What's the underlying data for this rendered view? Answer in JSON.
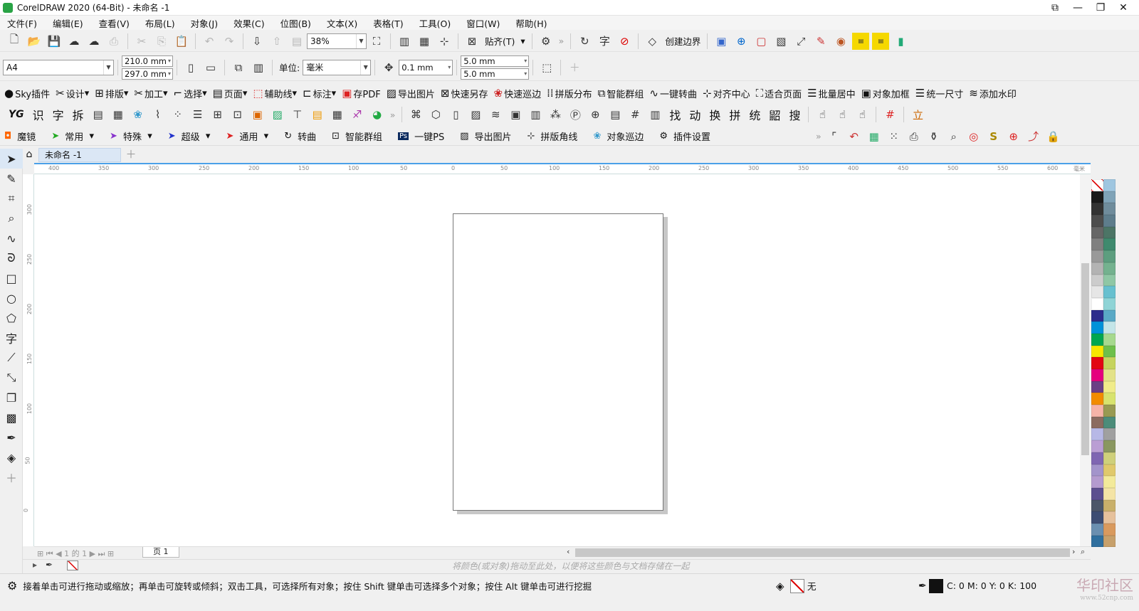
{
  "title": "CorelDRAW 2020 (64-Bit) - 未命名 -1",
  "menu": [
    "文件(F)",
    "编辑(E)",
    "查看(V)",
    "布局(L)",
    "对象(J)",
    "效果(C)",
    "位图(B)",
    "文本(X)",
    "表格(T)",
    "工具(O)",
    "窗口(W)",
    "帮助(H)"
  ],
  "std": {
    "zoom": "38%",
    "snap": "贴齐(T)",
    "create_boundary": "创建边界"
  },
  "prop": {
    "paper": "A4",
    "width": "210.0 mm",
    "height": "297.0 mm",
    "unit_label": "单位:",
    "unit": "毫米",
    "nudge": "0.1 mm",
    "dup_x": "5.0 mm",
    "dup_y": "5.0 mm"
  },
  "sky": [
    "Sky插件",
    "设计",
    "排版",
    "加工",
    "选择",
    "页面",
    "辅助线",
    "标注",
    "存PDF",
    "导出图片",
    "快速另存",
    "快速巡边",
    "拼版分布",
    "智能群组",
    "一键转曲",
    "对齐中心",
    "适合页面",
    "批量居中",
    "对象加框",
    "统一尺寸",
    "添加水印"
  ],
  "chars": [
    "识",
    "字",
    "拆",
    "找",
    "动",
    "换",
    "拼",
    "统",
    "鼦",
    "搜"
  ],
  "pt": [
    "魔镜",
    "常用",
    "特殊",
    "超级",
    "通用",
    "转曲",
    "智能群组",
    "一键PS",
    "导出图片",
    "拼版角线",
    "对象巡边",
    "插件设置"
  ],
  "doc_tab": "未命名 -1",
  "ruler_h": [
    "400",
    "350",
    "300",
    "250",
    "200",
    "150",
    "100",
    "50",
    "0",
    "50",
    "100",
    "150",
    "200",
    "250",
    "300",
    "350",
    "400",
    "450",
    "500",
    "550",
    "600"
  ],
  "ruler_unit": "毫米",
  "ruler_v": [
    "300",
    "250",
    "200",
    "150",
    "100",
    "50",
    "0"
  ],
  "pager": {
    "count": "1 的 1",
    "page": "页 1"
  },
  "dock_hint": "将颜色(或对象)拖动至此处，以便将这些颜色与文档存储在一起",
  "status": {
    "hint": "接着单击可进行拖动或缩放；再单击可旋转或倾斜；双击工具，可选择所有对象；按住 Shift 键单击可选择多个对象；按住 Alt 键单击可进行挖掘",
    "fill": "无",
    "cmyk": "C: 0 M: 0 Y: 0 K: 100",
    "wm": "华印社区",
    "wm_url": "www.52cnp.com"
  },
  "palette": [
    "#ffffff",
    "#9fc6e0",
    "#1a1a1a",
    "#7fa3b8",
    "#333333",
    "#6f8c9c",
    "#4d4d4d",
    "#5e7d8c",
    "#666666",
    "#4c7566",
    "#808080",
    "#3f8a6e",
    "#999999",
    "#5d9e7f",
    "#b3b3b3",
    "#74b28f",
    "#cccccc",
    "#8fc7a5",
    "#e6e6e6",
    "#67c0cf",
    "#ffffff",
    "#8fd4d6",
    "#2c2c8c",
    "#5aa9c6",
    "#0092d9",
    "#c4e5e8",
    "#00a650",
    "#a6d98e",
    "#f7e600",
    "#6ebf4b",
    "#e20613",
    "#c6d45e",
    "#e5007e",
    "#e3e288",
    "#6b3f85",
    "#f0ec8a",
    "#f28c00",
    "#d8e36e",
    "#f6b3a8",
    "#989a52",
    "#8b6b60",
    "#4c8c7a",
    "#b7b8e6",
    "#a0a0a0",
    "#ba9ed4",
    "#8a9760",
    "#7f66b2",
    "#cfd07b",
    "#a394cb",
    "#e0c96c",
    "#b49bcf",
    "#f3ea9a",
    "#5c4f8f",
    "#f4e4a6",
    "#4c5669",
    "#c9b06a",
    "#3d4d73",
    "#e6c19c",
    "#6a8fb0",
    "#d99a5e",
    "#2f6f9e",
    "#c7a06b"
  ]
}
